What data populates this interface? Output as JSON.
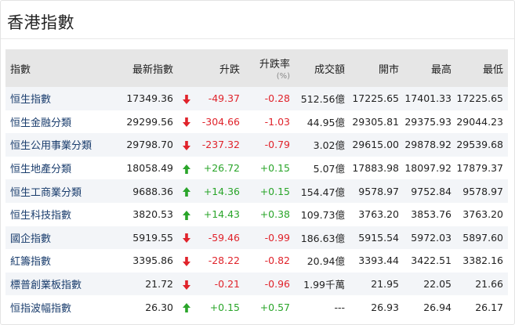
{
  "panel": {
    "title": "香港指數"
  },
  "columns": {
    "index": "指數",
    "last": "最新指數",
    "change": "升跌",
    "pct": "升跌率",
    "pct_unit": "(%)",
    "turnover": "成交額",
    "open": "開市",
    "high": "最高",
    "low": "最低"
  },
  "colors": {
    "up": "#2aa52a",
    "down": "#e0232b",
    "name": "#1a3d6d"
  },
  "rows": [
    {
      "name": "恒生指數",
      "last": "17349.36",
      "dir": "down",
      "change": "-49.37",
      "pct": "-0.28",
      "turnover": "512.56億",
      "open": "17225.65",
      "high": "17401.33",
      "low": "17225.65"
    },
    {
      "name": "恒生金融分類",
      "last": "29299.56",
      "dir": "down",
      "change": "-304.66",
      "pct": "-1.03",
      "turnover": "44.95億",
      "open": "29305.81",
      "high": "29375.93",
      "low": "29044.23"
    },
    {
      "name": "恒生公用事業分類",
      "last": "29798.70",
      "dir": "down",
      "change": "-237.32",
      "pct": "-0.79",
      "turnover": "3.02億",
      "open": "29615.00",
      "high": "29878.92",
      "low": "29539.68"
    },
    {
      "name": "恒生地產分類",
      "last": "18058.49",
      "dir": "up",
      "change": "+26.72",
      "pct": "+0.15",
      "turnover": "5.07億",
      "open": "17883.98",
      "high": "18097.92",
      "low": "17879.37"
    },
    {
      "name": "恒生工商業分類",
      "last": "9688.36",
      "dir": "up",
      "change": "+14.36",
      "pct": "+0.15",
      "turnover": "154.47億",
      "open": "9578.97",
      "high": "9752.84",
      "low": "9578.97"
    },
    {
      "name": "恒生科技指數",
      "last": "3820.53",
      "dir": "up",
      "change": "+14.43",
      "pct": "+0.38",
      "turnover": "109.73億",
      "open": "3763.20",
      "high": "3853.76",
      "low": "3763.20"
    },
    {
      "name": "國企指數",
      "last": "5919.55",
      "dir": "down",
      "change": "-59.46",
      "pct": "-0.99",
      "turnover": "186.63億",
      "open": "5915.54",
      "high": "5972.03",
      "low": "5897.60"
    },
    {
      "name": "紅籌指數",
      "last": "3395.86",
      "dir": "down",
      "change": "-28.22",
      "pct": "-0.82",
      "turnover": "20.94億",
      "open": "3393.44",
      "high": "3422.51",
      "low": "3382.16"
    },
    {
      "name": "標普創業板指數",
      "last": "21.72",
      "dir": "down",
      "change": "-0.21",
      "pct": "-0.96",
      "turnover": "1.99千萬",
      "open": "21.95",
      "high": "22.05",
      "low": "21.66"
    },
    {
      "name": "恒指波幅指數",
      "last": "26.30",
      "dir": "up",
      "change": "+0.15",
      "pct": "+0.57",
      "turnover": "---",
      "open": "26.93",
      "high": "26.94",
      "low": "26.17"
    }
  ]
}
